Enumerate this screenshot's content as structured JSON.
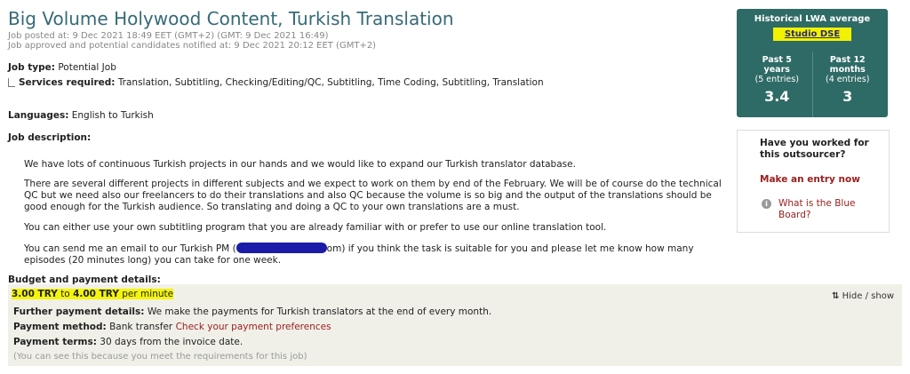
{
  "job": {
    "title": "Big Volume Holywood Content, Turkish Translation",
    "posted": "Job posted at: 9 Dec 2021 18:49 EET (GMT+2)  (GMT: 9 Dec 2021 16:49)",
    "approved": "Job approved and potential candidates notified at: 9 Dec 2021 20:12 EET (GMT+2)",
    "type_label": "Job type:",
    "type_value": "Potential Job",
    "services_label": "Services required:",
    "services_value": "Translation, Subtitling, Checking/Editing/QC, Subtitling, Time Coding, Subtitling, Translation",
    "languages_label": "Languages:",
    "languages_value": "English to Turkish",
    "description_label": "Job description:",
    "desc": {
      "p1": "We have lots of continuous Turkish projects in our hands and we would like to expand our Turkish translator database.",
      "p2": "There are several different projects in different subjects and we expect to work on them by end of the February. We will be of course do the technical QC but we need also our freelancers to do their translations and also QC because the volume is so big and the output of the translations should be good enough for the Turkish audience. So translating and doing a QC to your own translations are a must.",
      "p3": "You can either use your own subtitling program that you are already familiar with or prefer to use our online translation tool.",
      "p4_a": "You can send me an email to our Turkish PM (",
      "p4_b": "om) if you think the task is suitable for you and please let me know how many episodes (20 minutes long) you can take for one week."
    }
  },
  "budget": {
    "label": "Budget and payment details:",
    "rate_low": "3.00 TRY",
    "to": "to",
    "rate_high": "4.00 TRY",
    "per": "per minute",
    "hide_label": "Hide / show",
    "further_label": "Further payment details:",
    "further_value": "We make the payments for Turkish translators at the end of every month.",
    "method_label": "Payment method:",
    "method_value": "Bank transfer",
    "method_link": "Check your payment preferences",
    "terms_label": "Payment terms:",
    "terms_value": "30 days from the invoice date.",
    "note": "(You can see this because you meet the requirements for this job)"
  },
  "lwa": {
    "heading": "Historical LWA average",
    "studio": "Studio DSE",
    "col1": {
      "title": "Past 5 years",
      "entries": "(5 entries)",
      "score": "3.4"
    },
    "col2": {
      "title": "Past 12 months",
      "entries": "(4 entries)",
      "score": "3"
    }
  },
  "worked": {
    "question": "Have you worked for this outsourcer?",
    "entry_link": "Make an entry now",
    "blue_board": "What is the Blue Board?"
  }
}
